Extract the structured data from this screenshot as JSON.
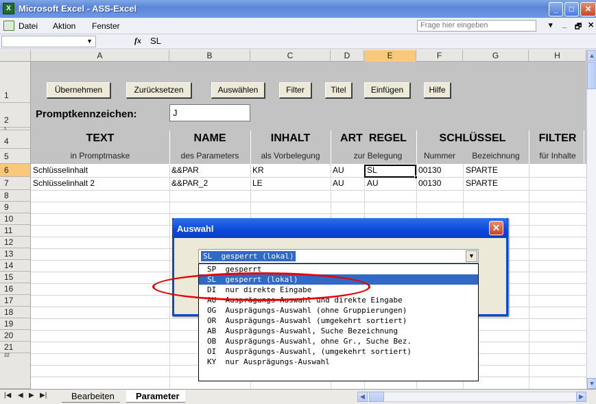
{
  "window": {
    "title": "Microsoft Excel - ASS-Excel",
    "app_icon": "excel-icon"
  },
  "menubar": {
    "items": [
      "Datei",
      "Aktion",
      "Fenster"
    ],
    "help_placeholder": "Frage hier eingeben"
  },
  "formula_bar": {
    "name_box": "",
    "fx": "fx",
    "value": "SL"
  },
  "columns": [
    "A",
    "B",
    "C",
    "D",
    "E",
    "F",
    "G",
    "H"
  ],
  "rows": [
    "1",
    "2",
    "3",
    "4",
    "5",
    "6",
    "7",
    "8",
    "9",
    "10",
    "11",
    "12",
    "13",
    "14",
    "15",
    "16",
    "17",
    "18",
    "19",
    "20",
    "21",
    "22"
  ],
  "selected_cell": {
    "column": "E",
    "row": "6"
  },
  "buttons": [
    "Übernehmen",
    "Zurücksetzen",
    "Auswählen",
    "Filter",
    "Titel",
    "Einfügen",
    "Hilfe"
  ],
  "prompt": {
    "label": "Promptkennzeichen:",
    "value": "J"
  },
  "headers_main": {
    "text": "TEXT",
    "name": "NAME",
    "inhalt": "INHALT",
    "art_regel": "ART  REGEL",
    "schluessel": "SCHLÜSSEL",
    "filter": "FILTER"
  },
  "headers_sub": {
    "text": "in Promptmaske",
    "name": "des Parameters",
    "inhalt": "als Vorbelegung",
    "regel": "zur Belegung",
    "nummer": "Nummer",
    "bezeichnung": "Bezeichnung",
    "filter": "für Inhalte"
  },
  "data_rows": [
    {
      "text": "Schlüsselinhalt",
      "name": "&&PAR",
      "inhalt": "KR",
      "art": "AU",
      "regel": "SL",
      "nummer": "00130",
      "bezeichnung": "SPARTE"
    },
    {
      "text": "Schlüsselinhalt 2",
      "name": "&&PAR_2",
      "inhalt": "LE",
      "art": "AU",
      "regel": "AU",
      "nummer": "00130",
      "bezeichnung": "SPARTE"
    }
  ],
  "dialog": {
    "title": "Auswahl",
    "selected": "SL  gesperrt (lokal)",
    "options": [
      "SP  gesperrt",
      "SL  gesperrt (lokal)",
      "DI  nur direkte Eingabe",
      "AU  Ausprägungs-Auswahl und direkte Eingabe",
      "OG  Ausprägungs-Auswahl (ohne Gruppierungen)",
      "OR  Ausprägungs-Auswahl (umgekehrt sortiert)",
      "AB  Ausprägungs-Auswahl, Suche Bezeichnung",
      "OB  Ausprägungs-Auswahl, ohne Gr., Suche Bez.",
      "OI  Ausprägungs-Auswahl, (umgekehrt sortiert)",
      "KY  nur Ausprägungs-Auswahl"
    ],
    "highlighted_index": 1
  },
  "sheet_tabs": [
    "Bearbeiten",
    "Parameter"
  ],
  "active_tab": "Parameter",
  "annotation": {
    "color": "#e60000",
    "shape": "ellipse"
  }
}
